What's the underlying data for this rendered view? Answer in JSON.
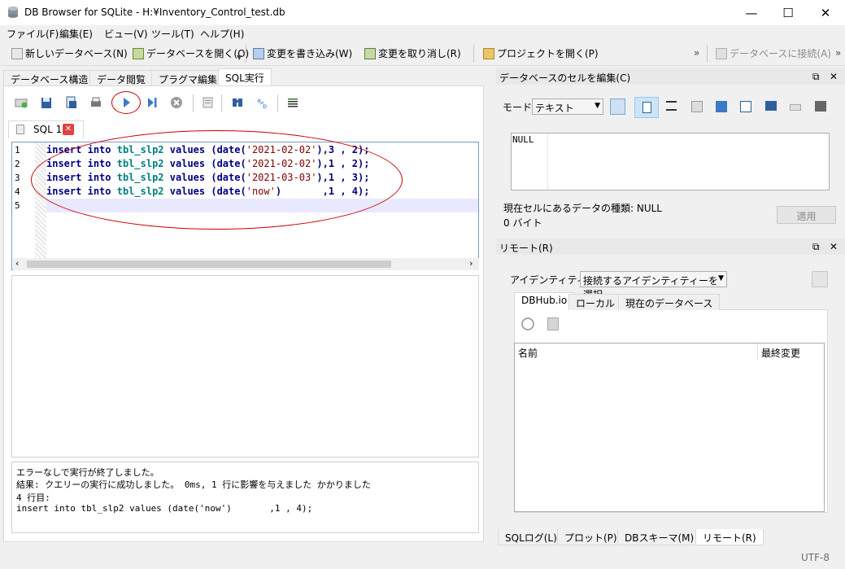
{
  "window": {
    "title": "DB Browser for SQLite - H:¥Inventory_Control_test.db",
    "minimize": "—",
    "maximize": "☐",
    "close": "✕"
  },
  "menu": [
    "ファイル(F)",
    "編集(E)",
    "ビュー(V)",
    "ツール(T)",
    "ヘルプ(H)"
  ],
  "toolbar": {
    "new_db": "新しいデータベース(N)",
    "open_db": "データベースを開く(O)",
    "write_changes": "変更を書き込み(W)",
    "revert_changes": "変更を取り消し(R)",
    "open_project": "プロジェクトを開く(P)",
    "connect_db": "データベースに接続(A)",
    "more1": "»",
    "more2": "»"
  },
  "main_tabs": [
    "データベース構造",
    "データ閲覧",
    "プラグマ編集",
    "SQL実行"
  ],
  "active_main_tab": "SQL実行",
  "sql_tab": {
    "label": "SQL 1",
    "close": "✕"
  },
  "editor": {
    "line_numbers": [
      "1",
      "2",
      "3",
      "4",
      "5"
    ],
    "lines": [
      {
        "kw1": "insert",
        "kw2": "into",
        "table": "tbl_slp2",
        "kw3": "values",
        "pre": "(date(",
        "str": "'2021-02-02'",
        "post": "),3 , 2);"
      },
      {
        "kw1": "insert",
        "kw2": "into",
        "table": "tbl_slp2",
        "kw3": "values",
        "pre": "(date(",
        "str": "'2021-02-02'",
        "post": "),1 , 2);"
      },
      {
        "kw1": "insert",
        "kw2": "into",
        "table": "tbl_slp2",
        "kw3": "values",
        "pre": "(date(",
        "str": "'2021-03-03'",
        "post": "),1 , 3);"
      },
      {
        "kw1": "insert",
        "kw2": "into",
        "table": "tbl_slp2",
        "kw3": "values",
        "pre": "(date(",
        "str": "'now'",
        "post": ")       ,1 , 4);"
      }
    ]
  },
  "messages": [
    "エラーなしで実行が終了しました。",
    "結果: クエリーの実行に成功しました。 0ms, 1 行に影響を与えました かかりました",
    "4 行目:",
    "insert into tbl_slp2 values (date('now')       ,1 , 4);"
  ],
  "cell_editor": {
    "title": "データベースのセルを編集(C)",
    "mode_label": "モード:",
    "mode_value": "テキスト",
    "content": "NULL",
    "type_info": "現在セルにあるデータの種類: NULL",
    "size_info": "0 バイト",
    "apply": "適用"
  },
  "remote": {
    "title": "リモート(R)",
    "identity_label": "アイデンティティー",
    "identity_value": "接続するアイデンティティーを選択",
    "tabs": [
      "DBHub.io",
      "ローカル",
      "現在のデータベース"
    ],
    "col_name": "名前",
    "col_modified": "最終変更"
  },
  "bottom_tabs": [
    "SQLログ(L)",
    "プロット(P)",
    "DBスキーマ(M)",
    "リモート(R)"
  ],
  "status": {
    "encoding": "UTF-8"
  },
  "colors": {
    "keyword": "#00007f",
    "string": "#7f0000",
    "annotation": "#cc0000",
    "accent": "#3b79c9"
  }
}
